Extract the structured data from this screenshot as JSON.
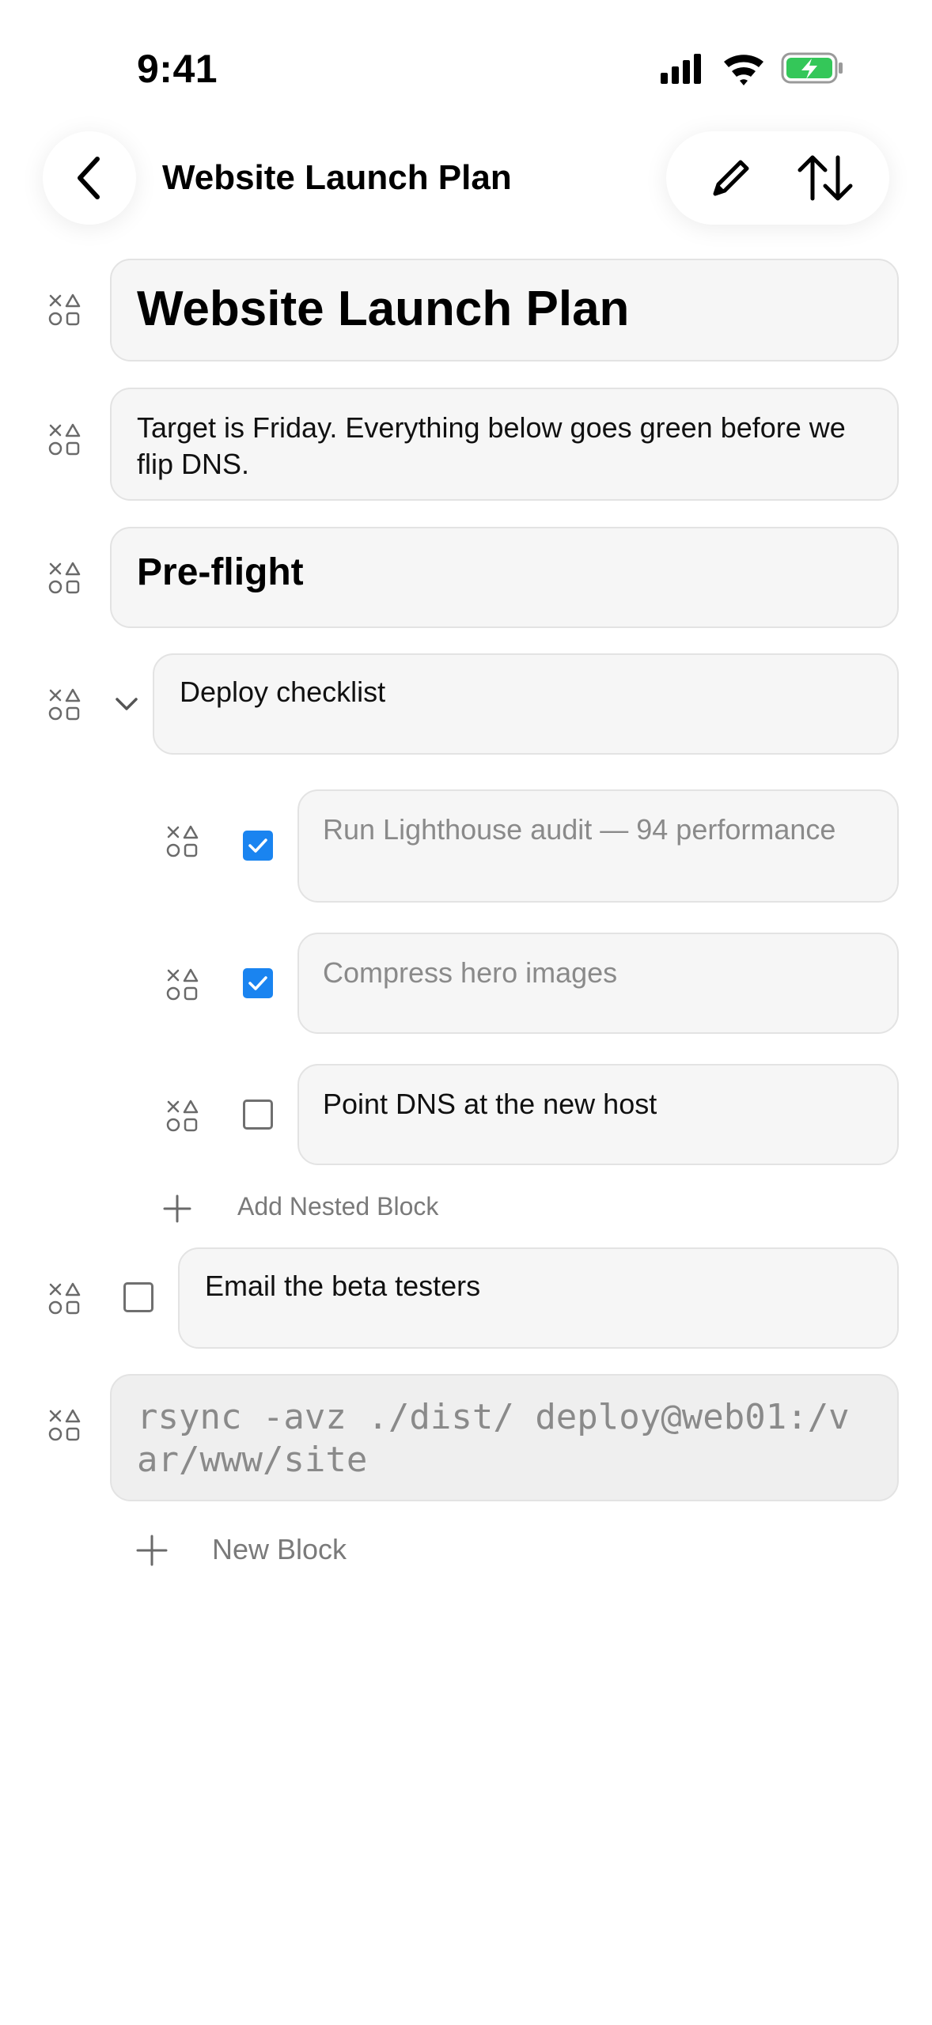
{
  "status_bar": {
    "time": "9:41"
  },
  "nav": {
    "title": "Website Launch Plan"
  },
  "blocks": {
    "title": "Website Launch Plan",
    "paragraph": "Target is Friday. Everything below goes green before we flip DNS.",
    "heading": "Pre-flight",
    "toggle": "Deploy checklist",
    "nested": [
      {
        "text": "Run Lighthouse audit — 94 performance",
        "checked": true
      },
      {
        "text": "Compress hero images",
        "checked": true
      },
      {
        "text": "Point DNS at the new host",
        "checked": false
      }
    ],
    "add_nested": "Add Nested Block",
    "todo": "Email the beta testers",
    "code": "rsync -avz ./dist/ deploy@web01:/var/www/site",
    "new_block": "New Block"
  },
  "colors": {
    "accent": "#1a84f0",
    "battery": "#34c759"
  }
}
